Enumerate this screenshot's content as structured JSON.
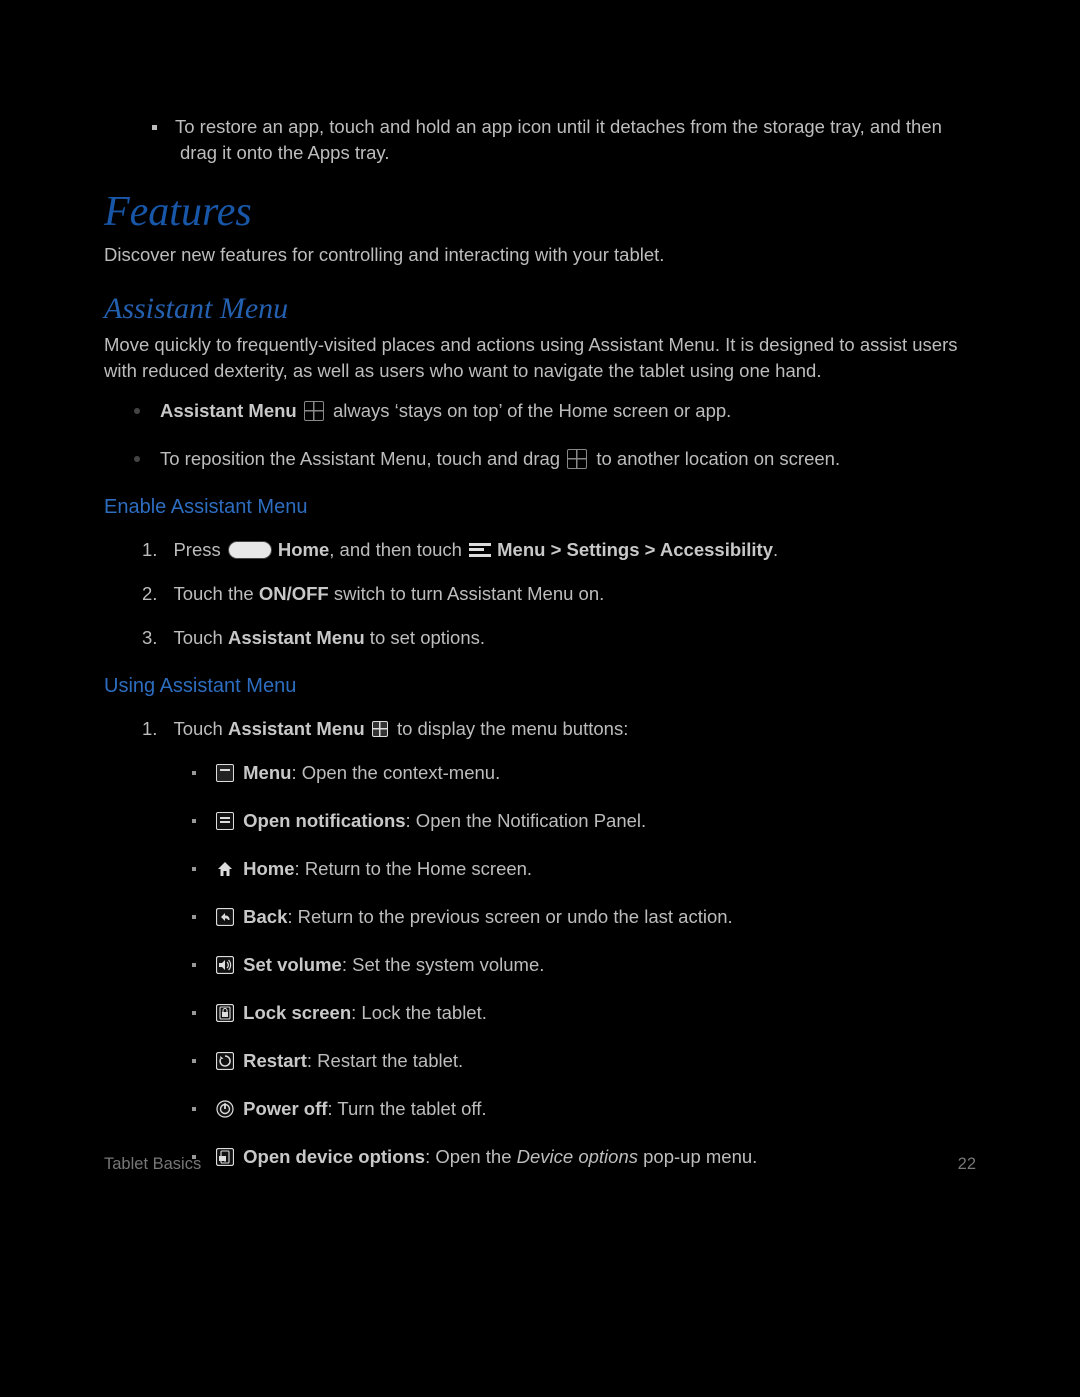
{
  "intro_bullet": "To restore an app, touch and hold an app icon until it detaches from the storage tray, and then drag it onto the Apps tray.",
  "features": {
    "heading": "Features",
    "intro": "Discover new features for controlling and interacting with your tablet."
  },
  "assistant": {
    "heading": "Assistant Menu",
    "intro": "Move quickly to frequently-visited places and actions using Assistant Menu. It is designed to assist users with reduced dexterity, as well as users who want to navigate the tablet using one hand.",
    "bullets": {
      "b1_bold": "Assistant Menu",
      "b1_tail": " always ‘stays on top’ of the Home screen or app.",
      "b2_lead": "To reposition the Assistant Menu, touch and drag ",
      "b2_tail": " to another location on screen."
    }
  },
  "enable": {
    "heading": "Enable Assistant Menu",
    "steps": {
      "s1_lead": "Press ",
      "s1_home": "Home",
      "s1_mid": ", and then touch ",
      "s1_path": "Menu > Settings > Accessibility",
      "s1_tail": ".",
      "s2_a": "Touch the ",
      "s2_b": "ON/OFF",
      "s2_c": " switch to turn Assistant Menu on.",
      "s3_a": "Touch ",
      "s3_b": "Assistant Menu",
      "s3_c": " to set options."
    }
  },
  "using": {
    "heading": "Using Assistant Menu",
    "step1_a": "Touch ",
    "step1_b": "Assistant Menu",
    "step1_c": " to display the menu buttons:",
    "items": {
      "menu": {
        "label": "Menu",
        "desc": ": Open the context-menu."
      },
      "open_notifications": {
        "label": "Open notifications",
        "desc": ": Open the Notification Panel."
      },
      "home": {
        "label": "Home",
        "desc": ": Return to the Home screen."
      },
      "back": {
        "label": "Back",
        "desc": ": Return to the previous screen or undo the last action."
      },
      "set_volume": {
        "label": "Set volume",
        "desc": ": Set the system volume."
      },
      "lock_screen": {
        "label": "Lock screen",
        "desc": ": Lock the tablet."
      },
      "restart": {
        "label": "Restart",
        "desc": ": Restart the tablet."
      },
      "power_off": {
        "label": "Power off",
        "desc": ": Turn the tablet off."
      },
      "open_device_options": {
        "label": "Open device options",
        "desc_a": ": Open the ",
        "desc_italic": "Device options",
        "desc_b": " pop-up menu."
      }
    }
  },
  "footer": {
    "left": "Tablet Basics",
    "right": "22"
  }
}
